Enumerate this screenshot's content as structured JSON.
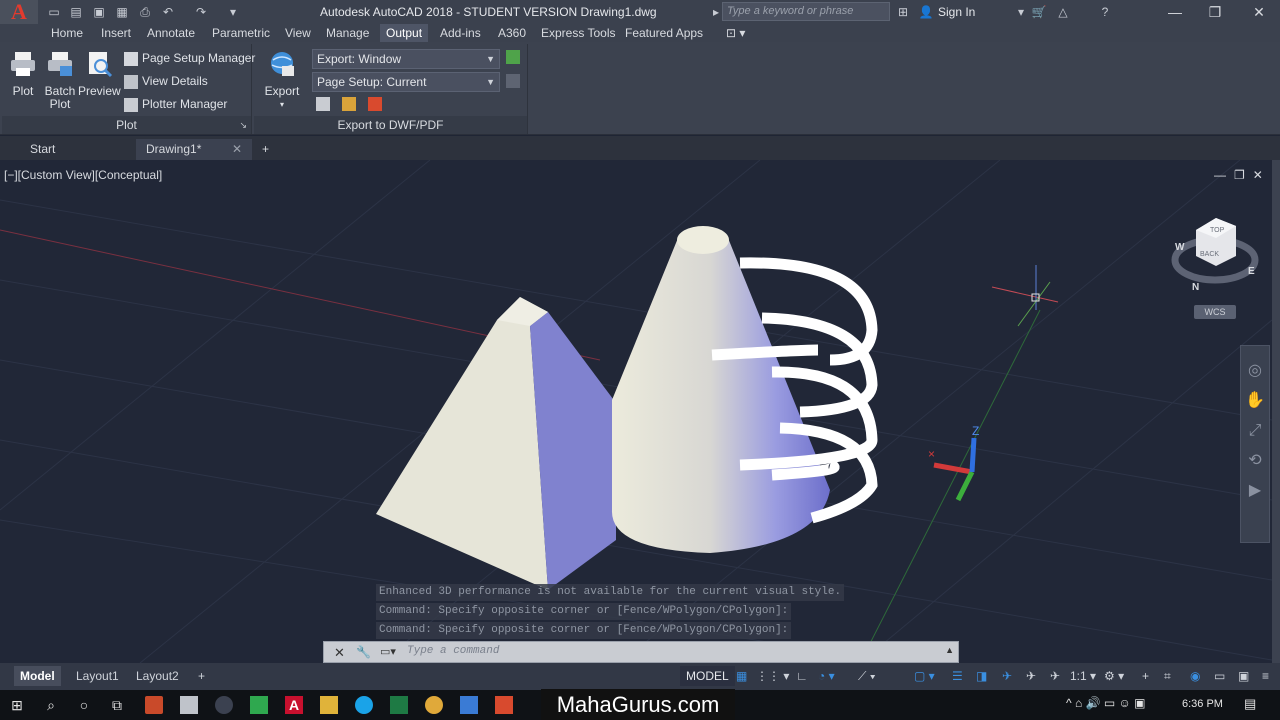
{
  "app": {
    "logo": "A",
    "title": "Autodesk AutoCAD 2018 - STUDENT VERSION    Drawing1.dwg",
    "search_placeholder": "Type a keyword or phrase",
    "sign_in": "Sign In"
  },
  "menu": {
    "tabs": [
      "Home",
      "Insert",
      "Annotate",
      "Parametric",
      "View",
      "Manage",
      "Output",
      "Add-ins",
      "A360",
      "Express Tools",
      "Featured Apps"
    ],
    "active": "Output"
  },
  "ribbon": {
    "plot_panel": {
      "title": "Plot",
      "plot": "Plot",
      "batch_plot_line1": "Batch",
      "batch_plot_line2": "Plot",
      "preview": "Preview",
      "page_setup_manager": "Page Setup Manager",
      "view_details": "View Details",
      "plotter_manager": "Plotter Manager"
    },
    "export_panel": {
      "title": "Export to DWF/PDF",
      "export": "Export",
      "export_window": "Export: Window",
      "page_setup": "Page Setup: Current"
    }
  },
  "file_tabs": {
    "start": "Start",
    "drawing": "Drawing1*",
    "add": "+"
  },
  "viewport": {
    "label": "[−][Custom View][Conceptual]",
    "viewcube_top": "TOP",
    "viewcube_back": "BACK",
    "compass_w": "W",
    "compass_n": "N",
    "compass_e": "E",
    "wcs": "WCS",
    "ucs_z": "Z"
  },
  "command": {
    "history": [
      "Enhanced 3D performance is not available for the current visual style.",
      "Command: Specify opposite corner or [Fence/WPolygon/CPolygon]:",
      "Command: Specify opposite corner or [Fence/WPolygon/CPolygon]:"
    ],
    "placeholder": "Type a command"
  },
  "layout_tabs": [
    "Model",
    "Layout1",
    "Layout2"
  ],
  "status": {
    "model": "MODEL",
    "scale": "1:1"
  },
  "taskbar": {
    "watermark": "MahaGurus.com",
    "time": "6:36 PM"
  },
  "colors": {
    "viewport_bg": "#212737",
    "accent_blue": "#2f8fe0",
    "solid_light": "#e6e5d8",
    "solid_shade": "#7e80c8"
  }
}
